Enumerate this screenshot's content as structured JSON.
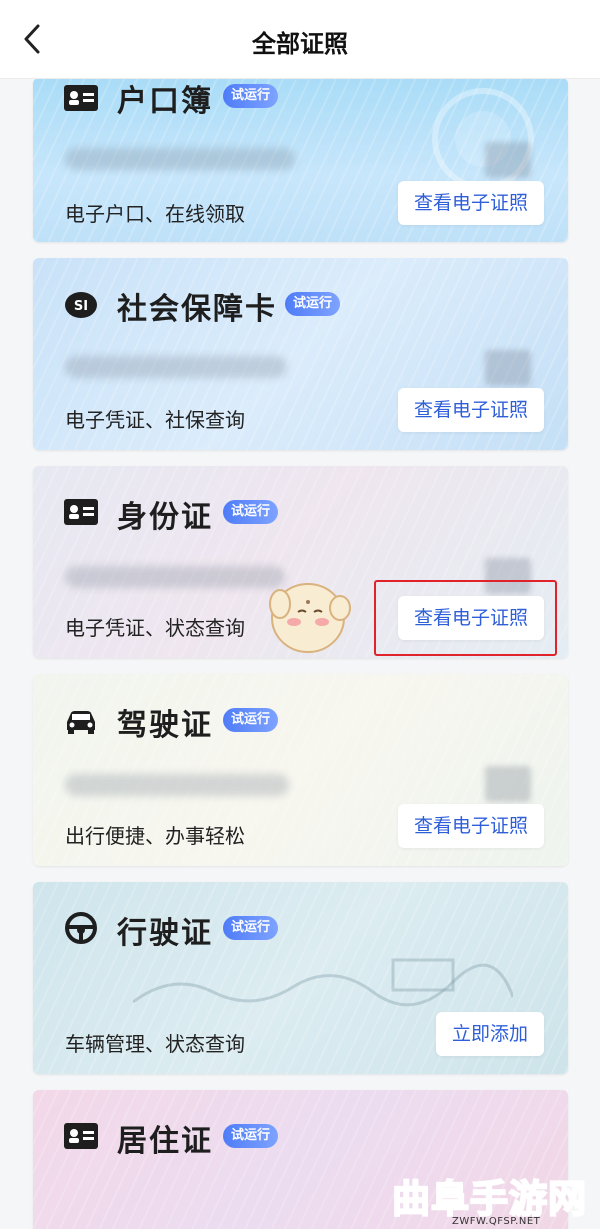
{
  "header": {
    "title": "全部证照"
  },
  "badge_text": "试运行",
  "cards": [
    {
      "title": "户口簿",
      "desc": "电子户口、在线领取",
      "action": "查看电子证照"
    },
    {
      "title": "社会保障卡",
      "desc": "电子凭证、社保查询",
      "action": "查看电子证照"
    },
    {
      "title": "身份证",
      "desc": "电子凭证、状态查询",
      "action": "查看电子证照"
    },
    {
      "title": "驾驶证",
      "desc": "出行便捷、办事轻松",
      "action": "查看电子证照"
    },
    {
      "title": "行驶证",
      "desc": "车辆管理、状态查询",
      "action": "立即添加"
    },
    {
      "title": "居住证",
      "desc": "",
      "action": ""
    }
  ],
  "watermark": {
    "text": "曲阜手游网",
    "url": "ZWFW.QFSP.NET"
  },
  "colors": {
    "badge": "#4f7cf7",
    "button_text": "#2f5fd8",
    "highlight": "#e0222a",
    "watermark": "#e0245e"
  }
}
